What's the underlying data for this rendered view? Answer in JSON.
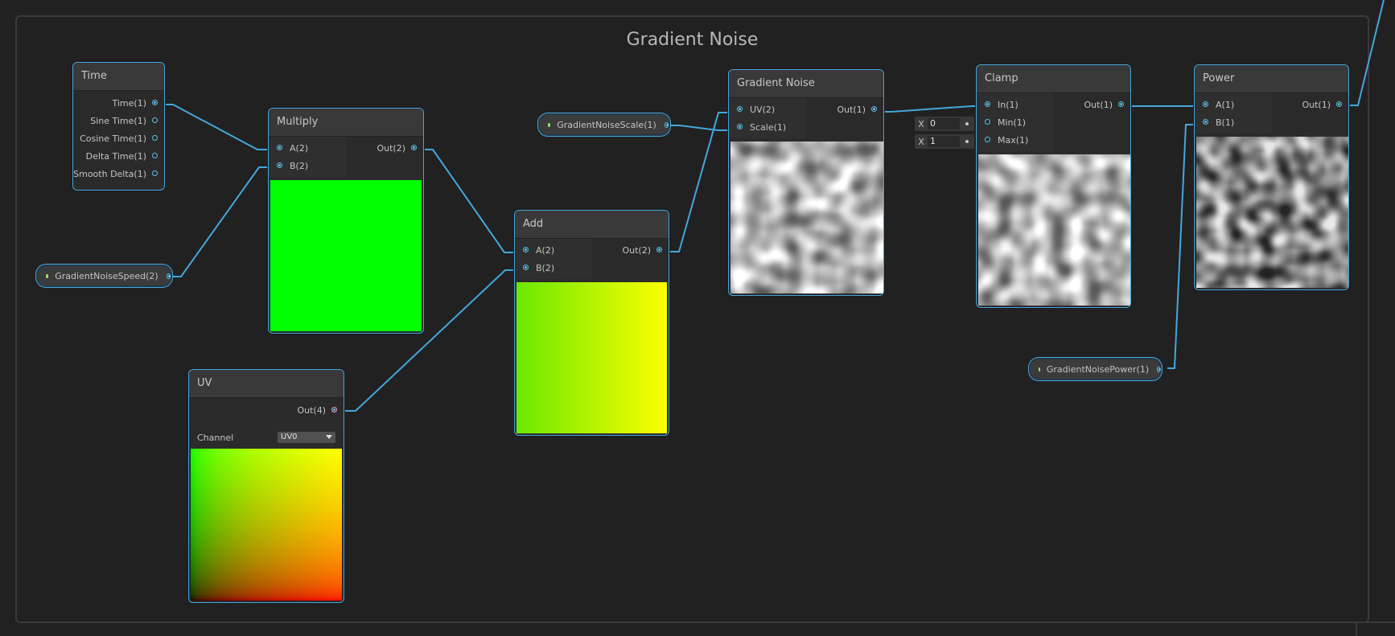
{
  "group": {
    "title": "Gradient Noise"
  },
  "nodes": {
    "time": {
      "title": "Time",
      "outputs": [
        "Time(1)",
        "Sine Time(1)",
        "Cosine Time(1)",
        "Delta Time(1)",
        "Smooth Delta(1)"
      ]
    },
    "multiply": {
      "title": "Multiply",
      "inputs": [
        "A(2)",
        "B(2)"
      ],
      "output": "Out(2)",
      "preview_color": "#00ff00"
    },
    "add": {
      "title": "Add",
      "inputs": [
        "A(2)",
        "B(2)"
      ],
      "output": "Out(2)"
    },
    "uv": {
      "title": "UV",
      "output": "Out(4)",
      "channel_label": "Channel",
      "channel_value": "UV0"
    },
    "gradient_noise": {
      "title": "Gradient Noise",
      "inputs": [
        "UV(2)",
        "Scale(1)"
      ],
      "output": "Out(1)"
    },
    "clamp": {
      "title": "Clamp",
      "inputs": [
        "In(1)",
        "Min(1)",
        "Max(1)"
      ],
      "output": "Out(1)",
      "min_field": {
        "label": "X",
        "value": "0"
      },
      "max_field": {
        "label": "X",
        "value": "1"
      }
    },
    "power": {
      "title": "Power",
      "inputs": [
        "A(1)",
        "B(1)"
      ],
      "output": "Out(1)"
    }
  },
  "properties": {
    "speed": "GradientNoiseSpeed(2)",
    "scale": "GradientNoiseScale(1)",
    "power": "GradientNoisePower(1)"
  },
  "colors": {
    "wire": "#45a7dc",
    "port": "#5ec0e6",
    "property_dot": "#9de86a",
    "background": "#212121"
  }
}
